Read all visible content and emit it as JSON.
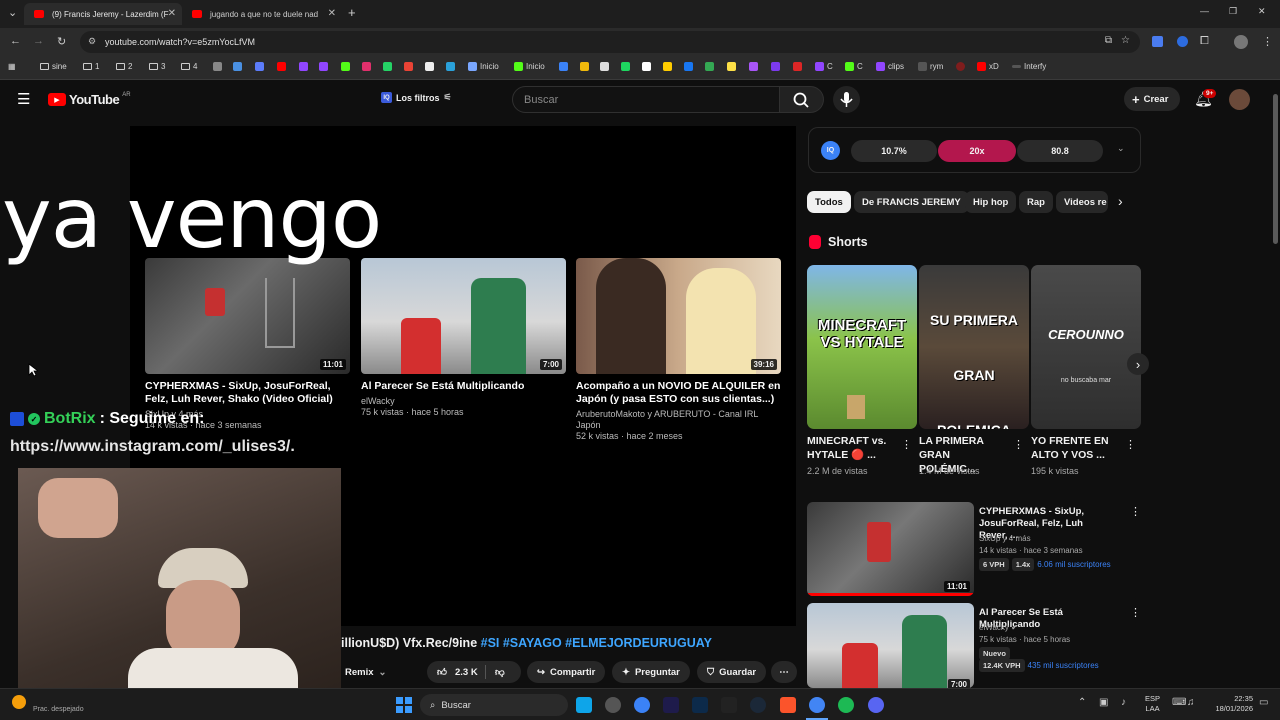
{
  "browser": {
    "tabs": [
      {
        "title": "(9) Francis Jeremy - Lazerdim (F",
        "active": true
      },
      {
        "title": "jugando a que no te duele nad",
        "active": false
      }
    ],
    "new_tab": "+",
    "url": "youtube.com/watch?v=e5zmYocLfVM",
    "window_controls": {
      "minimize": "—",
      "restore": "❐",
      "close": "✕"
    }
  },
  "bookmarks": [
    {
      "label": "sine",
      "type": "folder"
    },
    {
      "label": "1",
      "type": "folder"
    },
    {
      "label": "2",
      "type": "folder"
    },
    {
      "label": "3",
      "type": "folder"
    },
    {
      "label": "4",
      "type": "folder"
    },
    {
      "label": "Inicio",
      "type": "site"
    },
    {
      "label": "Inicio",
      "type": "site"
    },
    {
      "label": "C",
      "type": "site"
    },
    {
      "label": "C",
      "type": "site"
    },
    {
      "label": "clips",
      "type": "site"
    },
    {
      "label": "rym",
      "type": "site"
    },
    {
      "label": "xD",
      "type": "site"
    },
    {
      "label": "Interfy",
      "type": "site"
    }
  ],
  "youtube": {
    "logo": "YouTube",
    "region": "AR",
    "filters_label": "Los filtros",
    "search_placeholder": "Buscar",
    "create_label": "Crear",
    "notif_count": "9+",
    "iq": {
      "icon_label": "IQ",
      "a": "10.7%",
      "b": "20x",
      "c": "80.8"
    },
    "chips": [
      "Todos",
      "De FRANCIS JEREMY",
      "Hip hop",
      "Rap",
      "Videos re"
    ],
    "shorts_title": "Shorts",
    "shorts": [
      {
        "overlay": "MINECRAFT VS HYTALE",
        "title": "MINECRAFT vs. HYTALE 🔴 ...",
        "views": "2.2 M de vistas"
      },
      {
        "overlay": "SU PRIMERA GRAN POLEMICA",
        "title": "LA PRIMERA GRAN POLÉMIC...",
        "views": "1.4 M de vistas"
      },
      {
        "overlay": "CEROUNNO",
        "sub": "no buscaba mar",
        "title": "YO FRENTE EN ALTO Y VOS ...",
        "views": "195 k vistas"
      }
    ],
    "recs": [
      {
        "title": "CYPHERXMAS - SixUp, JosuForReal, Felz, Luh Rever, ...",
        "channel": "SixUp y 4 más",
        "meta": "14 k vistas · hace 3 semanas",
        "badges": [
          "6 VPH",
          "1.4x"
        ],
        "subs": "6.06 mil suscriptores",
        "duration": "11:01"
      },
      {
        "title": "Al Parecer Se Está Multiplicando",
        "channel": "elWacky",
        "meta": "75 k vistas · hace 5 horas",
        "badges": [
          "Nuevo",
          "12.4K VPH"
        ],
        "subs": "435 mil suscriptores",
        "duration": "7:00"
      }
    ]
  },
  "player": {
    "overlay_text": "ya vengo",
    "endcards": [
      {
        "title": "CYPHERXMAS - SixUp, JosuForReal, Felz, Luh Rever, Shako (Video Oficial)",
        "meta1": "SixUp y 4 más",
        "meta2": "14 k vistas · hace 3 semanas",
        "duration": "11:01"
      },
      {
        "title": "Al Parecer Se Está Multiplicando",
        "meta1": "elWacky",
        "meta2": "75 k vistas · hace 5 horas",
        "duration": "7:00"
      },
      {
        "title": "Acompaño a un NOVIO DE ALQUILER en Japón (y pasa ESTO con sus clientas...)",
        "meta1": "AruberutoMakoto y ARUBERUTO - Canal IRL Japón",
        "meta2": "52 k vistas · hace 2 meses",
        "duration": "39:16"
      }
    ],
    "chat_user": "BotRix",
    "chat_msg": " : Seguime en:",
    "chat_link": "https://www.instagram.com/_ulises3/.",
    "video_title_tail": "illionU$D) Vfx.Rec/9ine ",
    "video_hashtags": "#SI #SAYAGO #ELMEJORDEURUGUAY",
    "remix_label": "Remix",
    "likes": "2.3 K",
    "share": "Compartir",
    "ask": "Preguntar",
    "save": "Guardar"
  },
  "taskbar": {
    "search": "Buscar",
    "weather": "Prac. despejado",
    "lang1": "ESP",
    "lang2": "LAA",
    "time": "22:35",
    "date": "18/01/2026"
  }
}
